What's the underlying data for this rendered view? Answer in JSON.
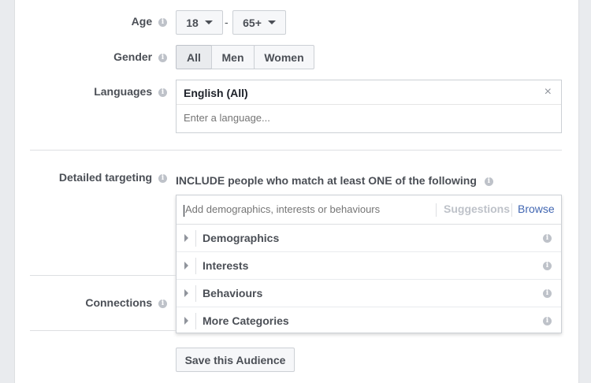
{
  "age": {
    "label": "Age",
    "min": "18",
    "separator": "-",
    "max": "65+"
  },
  "gender": {
    "label": "Gender",
    "options": [
      "All",
      "Men",
      "Women"
    ],
    "selected": "All"
  },
  "languages": {
    "label": "Languages",
    "selected": "English (All)",
    "placeholder": "Enter a language..."
  },
  "detailed_targeting": {
    "label": "Detailed targeting",
    "include_text": "INCLUDE people who match at least ONE of the following",
    "placeholder": "Add demographics, interests or behaviours",
    "suggestions_label": "Suggestions",
    "browse_label": "Browse",
    "categories": [
      "Demographics",
      "Interests",
      "Behaviours",
      "More Categories"
    ]
  },
  "connections": {
    "label": "Connections"
  },
  "save_button": "Save this Audience",
  "colors": {
    "accent": "#4267b2",
    "selected_bg": "#e9ebee",
    "border": "#ccd0d5",
    "info_icon": "#bec2c9"
  }
}
